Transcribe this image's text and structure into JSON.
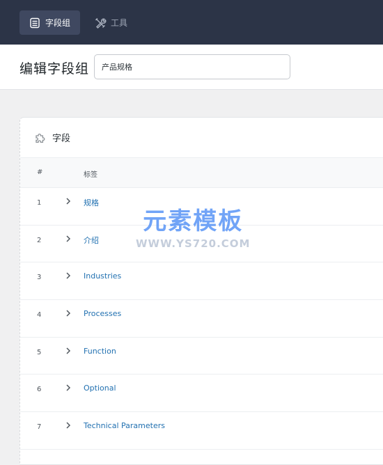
{
  "topbar": {
    "tabs": [
      {
        "label": "字段组",
        "icon": "list-icon",
        "active": true
      },
      {
        "label": "工具",
        "icon": "tools-icon",
        "active": false
      }
    ]
  },
  "header": {
    "title": "编辑字段组",
    "group_name_value": "产品规格"
  },
  "fields_panel": {
    "title": "字段",
    "icon": "puzzle-icon",
    "columns": [
      "#",
      "标签"
    ],
    "rows": [
      {
        "num": "1",
        "label": "规格"
      },
      {
        "num": "2",
        "label": "介绍"
      },
      {
        "num": "3",
        "label": "Industries"
      },
      {
        "num": "4",
        "label": "Processes"
      },
      {
        "num": "5",
        "label": "Function"
      },
      {
        "num": "6",
        "label": "Optional"
      },
      {
        "num": "7",
        "label": "Technical Parameters"
      }
    ]
  },
  "watermark": {
    "main": "元素模板",
    "sub": "WWW.YS720.COM"
  },
  "colors": {
    "topbar_bg": "#2c3447",
    "active_tab_bg": "#3f4860",
    "link": "#2271b1",
    "watermark": "#4285f4"
  }
}
